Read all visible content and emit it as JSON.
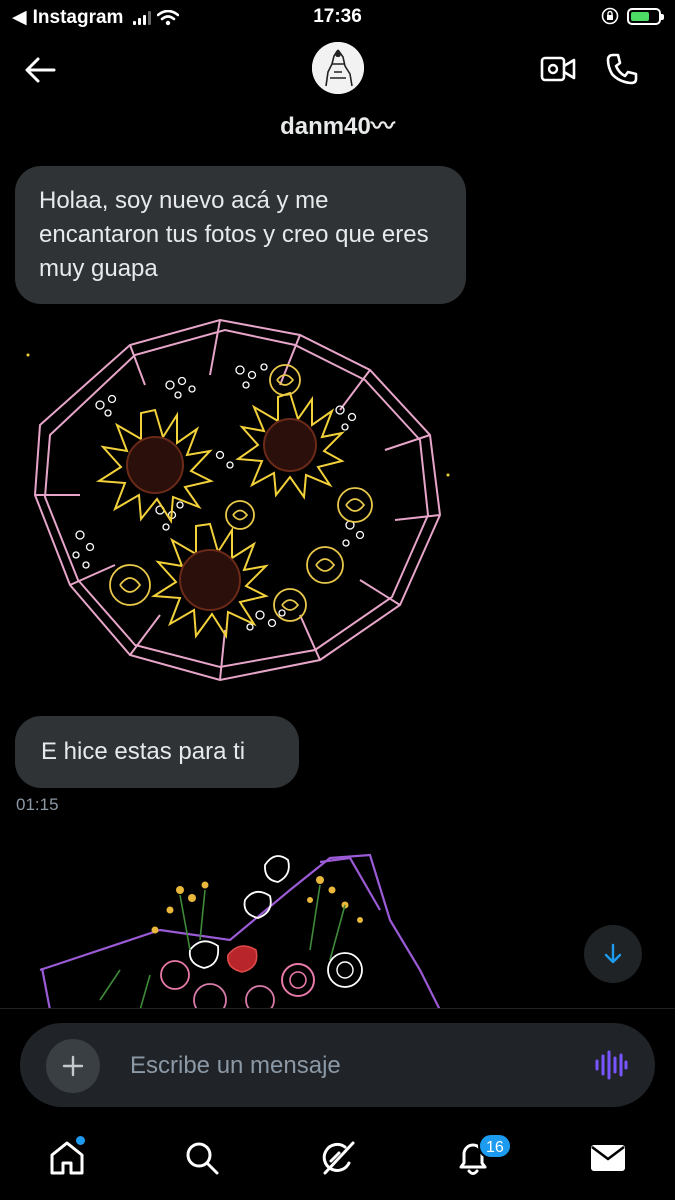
{
  "status_bar": {
    "back_app": "Instagram",
    "time": "17:36"
  },
  "header": {
    "username": "danm40〰"
  },
  "messages": [
    {
      "text": "Holaa, soy nuevo acá y me encantaron tus fotos y creo que eres muy guapa"
    },
    {
      "text": "E hice estas para ti",
      "time": "01:15"
    }
  ],
  "composer": {
    "placeholder": "Escribe un mensaje"
  },
  "tabbar": {
    "notifications_count": "16"
  },
  "colors": {
    "accent": "#1d9bf0",
    "bubble": "#2f3336",
    "voice": "#7856ff"
  },
  "icons": [
    "back-arrow-icon",
    "video-call-icon",
    "phone-icon",
    "plus-icon",
    "voice-wave-icon",
    "home-icon",
    "search-icon",
    "grok-icon",
    "bell-icon",
    "mail-icon",
    "arrow-down-icon"
  ]
}
